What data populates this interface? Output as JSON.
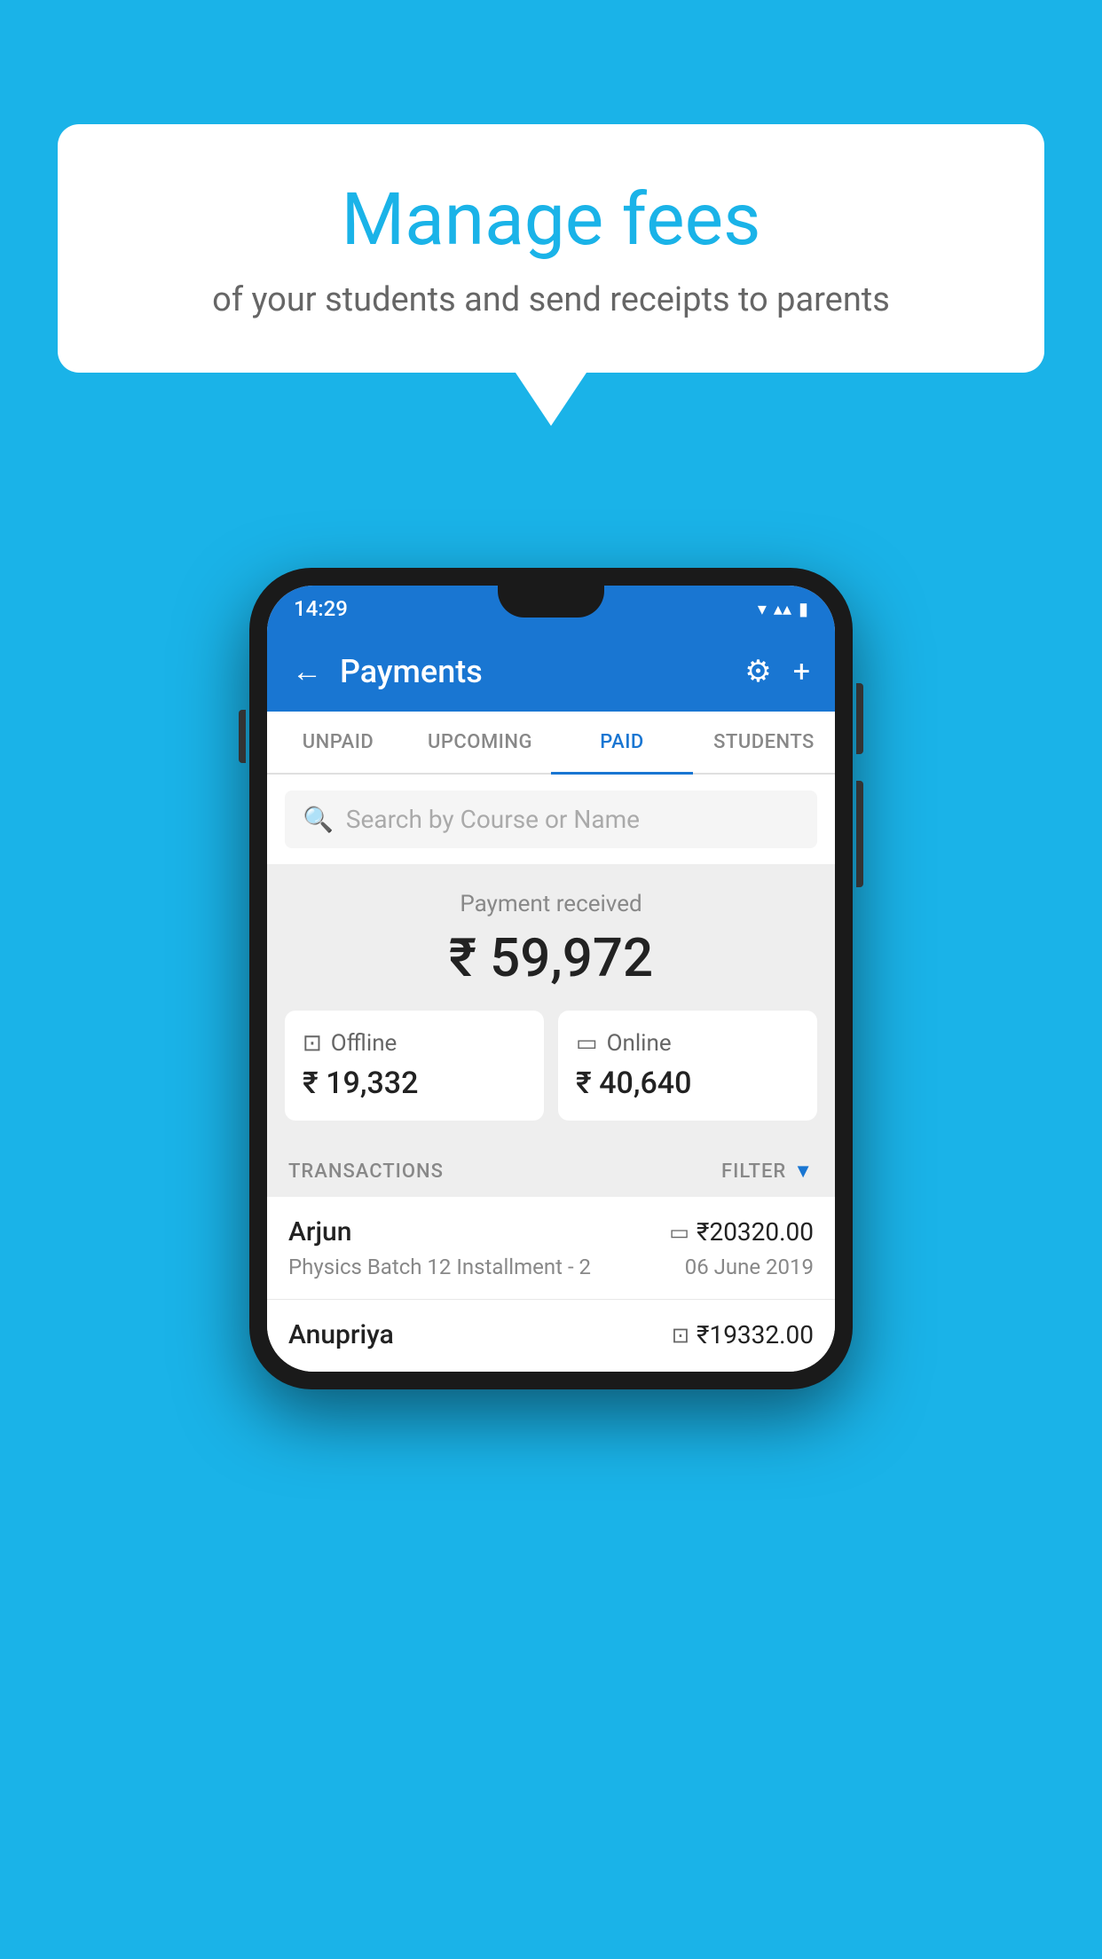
{
  "background_color": "#1ab3e8",
  "speech_bubble": {
    "title": "Manage fees",
    "subtitle": "of your students and send receipts to parents"
  },
  "status_bar": {
    "time": "14:29",
    "wifi_icon": "▼",
    "signal_icon": "▲",
    "battery_icon": "▮"
  },
  "app_bar": {
    "back_icon": "←",
    "title": "Payments",
    "settings_icon": "⚙",
    "add_icon": "+"
  },
  "tabs": [
    {
      "label": "UNPAID",
      "active": false
    },
    {
      "label": "UPCOMING",
      "active": false
    },
    {
      "label": "PAID",
      "active": true
    },
    {
      "label": "STUDENTS",
      "active": false
    }
  ],
  "search": {
    "placeholder": "Search by Course or Name"
  },
  "payment_summary": {
    "label": "Payment received",
    "amount": "₹ 59,972"
  },
  "payment_cards": [
    {
      "type": "Offline",
      "amount": "₹ 19,332",
      "icon": "💳"
    },
    {
      "type": "Online",
      "amount": "₹ 40,640",
      "icon": "💳"
    }
  ],
  "transactions_section": {
    "label": "TRANSACTIONS",
    "filter_label": "FILTER"
  },
  "transactions": [
    {
      "name": "Arjun",
      "detail": "Physics Batch 12 Installment - 2",
      "amount": "₹20320.00",
      "date": "06 June 2019",
      "payment_type": "online"
    },
    {
      "name": "Anupriya",
      "detail": "",
      "amount": "₹19332.00",
      "date": "",
      "payment_type": "offline"
    }
  ]
}
